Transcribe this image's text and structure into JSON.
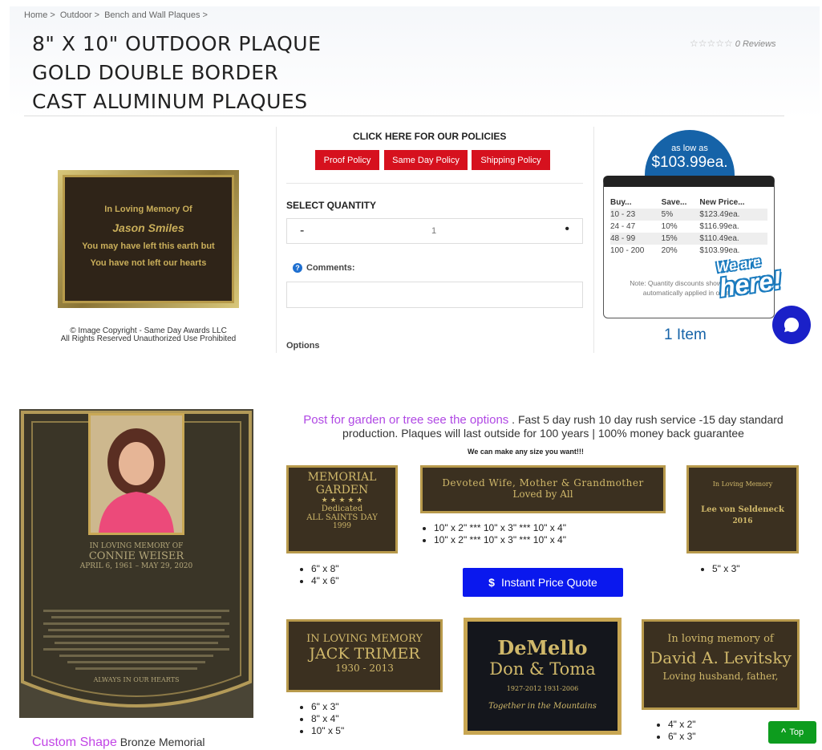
{
  "breadcrumb": [
    "Home",
    ">",
    "Outdoor",
    ">",
    "Bench and Wall Plaques",
    ">"
  ],
  "product": {
    "title_lines": [
      "8\" X 10\" OUTDOOR PLAQUE",
      "GOLD DOUBLE BORDER",
      "CAST ALUMINUM PLAQUES"
    ],
    "stars": "☆☆☆☆☆",
    "reviews": "0 Reviews",
    "image_text": [
      "In Loving Memory Of",
      "Jason Smiles",
      "You may have left this earth but",
      "You have not left our hearts"
    ],
    "copyright": [
      "© Image Copyright - Same Day Awards LLC",
      "All Rights Reserved   Unauthorized Use Prohibited"
    ]
  },
  "policies": {
    "heading": "CLICK HERE FOR OUR POLICIES",
    "buttons": [
      "Proof Policy",
      "Same Day Policy",
      "Shipping Policy"
    ]
  },
  "quantity": {
    "label": "SELECT QUANTITY",
    "minus": "-",
    "value": "1",
    "plus": "•"
  },
  "comments": {
    "icon": "?",
    "label": "Comments:"
  },
  "options_label": "Options",
  "pricing": {
    "as_low_as": "as low as",
    "price": "$103.99ea.",
    "headers": [
      "Buy...",
      "Save...",
      "New Price..."
    ],
    "rows": [
      [
        "10 - 23",
        "5%",
        "$123.49ea."
      ],
      [
        "24 - 47",
        "10%",
        "$116.99ea."
      ],
      [
        "48 - 99",
        "15%",
        "$110.49ea."
      ],
      [
        "100 - 200",
        "20%",
        "$103.99ea."
      ]
    ],
    "note": "Note: Quantity discounts shown will be automatically applied in order.",
    "items": "1 Item"
  },
  "chat": {
    "line1": "We are",
    "line2": "here!"
  },
  "memorial": {
    "lines": [
      "IN LOVING MEMORY OF",
      "CONNIE WEISER",
      "APRIL 6, 1961 – MAY 29, 2020",
      "ALWAYS IN OUR HEARTS"
    ],
    "caption_highlight": "Custom Shape",
    "caption_rest": " Bronze Memorial"
  },
  "info": {
    "highlight": "Post for garden or tree see the options",
    "text": " . Fast 5 day rush 10 day rush service -15 day standard production. Plaques will last outside for 100 years | 100% money back guarantee",
    "any_size": "We can make any size you want!!!"
  },
  "samples": {
    "garden": {
      "lines": [
        "MEMORIAL",
        "GARDEN",
        "★ ★ ★ ★ ★",
        "Dedicated",
        "ALL SAINTS DAY",
        "1999"
      ],
      "sizes": [
        "6\" x 8\"",
        "4\" x 6\""
      ]
    },
    "devoted": {
      "lines": [
        "Devoted Wife, Mother & Grandmother",
        "Loved by All"
      ],
      "sizes": [
        "10\" x 2\" *** 10\" x 3\" *** 10\" x 4\"",
        "10\" x 2\" *** 10\" x 3\" *** 10\" x 4\""
      ]
    },
    "seldeneck": {
      "lines": [
        "In Loving Memory",
        "Lee von Seldeneck",
        "2016"
      ],
      "sizes": [
        "5\" x 3\""
      ]
    },
    "trimer": {
      "lines": [
        "IN LOVING MEMORY",
        "JACK TRIMER",
        "1930 - 2013"
      ],
      "sizes": [
        "6\" x 3\"",
        "8\" x 4\"",
        "10\" x 5\""
      ]
    },
    "demello": {
      "lines": [
        "DeMello",
        "Don & Toma",
        "1927-2012  1931-2006",
        "Together in the Mountains"
      ]
    },
    "levitsky": {
      "lines": [
        "In loving memory of",
        "David A. Levitsky",
        "Loving husband, father,"
      ],
      "sizes": [
        "4\" x 2\"",
        "6\" x 3\""
      ]
    }
  },
  "quote_button": {
    "icon": "$",
    "label": "Instant Price Quote"
  },
  "top_button": {
    "icon": "^",
    "label": "Top"
  },
  "colors": {
    "policy_red": "#d6111e",
    "price_blue": "#1663a8",
    "quote_blue": "#0a18ee",
    "top_green": "#0d9c1e",
    "highlight_purple": "#b048e4"
  }
}
